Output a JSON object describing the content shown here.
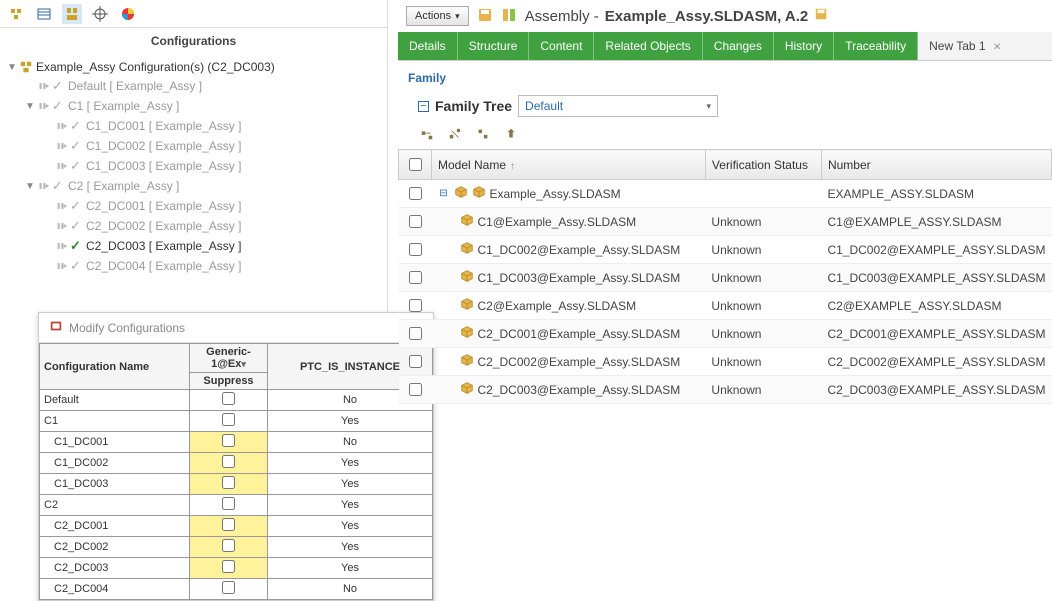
{
  "leftPanel": {
    "title": "Configurations",
    "rootLabel": "Example_Assy Configuration(s)  (C2_DC003)",
    "nodes": [
      {
        "label": "Default [ Example_Assy ]",
        "indent": 1,
        "checked": false,
        "dark": false
      },
      {
        "label": "C1 [ Example_Assy ]",
        "indent": 1,
        "checked": false,
        "dark": false,
        "toggle": "▼"
      },
      {
        "label": "C1_DC001 [ Example_Assy ]",
        "indent": 2,
        "checked": false,
        "dark": false
      },
      {
        "label": "C1_DC002 [ Example_Assy ]",
        "indent": 2,
        "checked": false,
        "dark": false
      },
      {
        "label": "C1_DC003 [ Example_Assy ]",
        "indent": 2,
        "checked": false,
        "dark": false
      },
      {
        "label": "C2 [ Example_Assy ]",
        "indent": 1,
        "checked": false,
        "dark": false,
        "toggle": "▼"
      },
      {
        "label": "C2_DC001 [ Example_Assy ]",
        "indent": 2,
        "checked": false,
        "dark": false
      },
      {
        "label": "C2_DC002 [ Example_Assy ]",
        "indent": 2,
        "checked": false,
        "dark": false
      },
      {
        "label": "C2_DC003 [ Example_Assy ]",
        "indent": 2,
        "checked": true,
        "dark": true
      },
      {
        "label": "C2_DC004 [ Example_Assy ]",
        "indent": 2,
        "checked": false,
        "dark": false
      }
    ]
  },
  "dialog": {
    "title": "Modify Configurations",
    "col1": "Configuration Name",
    "col2a": "Generic-1@Ex",
    "col2b": "Suppress",
    "col3": "PTC_IS_INSTANCE",
    "rows": [
      {
        "name": "Default",
        "indent": 0,
        "yellow": false,
        "ptc": "No"
      },
      {
        "name": "C1",
        "indent": 0,
        "yellow": false,
        "ptc": "Yes"
      },
      {
        "name": "C1_DC001",
        "indent": 1,
        "yellow": true,
        "ptc": "No"
      },
      {
        "name": "C1_DC002",
        "indent": 1,
        "yellow": true,
        "ptc": "Yes"
      },
      {
        "name": "C1_DC003",
        "indent": 1,
        "yellow": true,
        "ptc": "Yes"
      },
      {
        "name": "C2",
        "indent": 0,
        "yellow": false,
        "ptc": "Yes"
      },
      {
        "name": "C2_DC001",
        "indent": 1,
        "yellow": true,
        "ptc": "Yes"
      },
      {
        "name": "C2_DC002",
        "indent": 1,
        "yellow": true,
        "ptc": "Yes"
      },
      {
        "name": "C2_DC003",
        "indent": 1,
        "yellow": true,
        "ptc": "Yes"
      },
      {
        "name": "C2_DC004",
        "indent": 1,
        "yellow": false,
        "ptc": "No"
      }
    ]
  },
  "rightPanel": {
    "actionsLabel": "Actions",
    "titlePrefix": "Assembly - ",
    "titleBold": "Example_Assy.SLDASM, A.2",
    "tabs": [
      "Details",
      "Structure",
      "Content",
      "Related Objects",
      "Changes",
      "History",
      "Traceability"
    ],
    "newTab": "New Tab 1",
    "sectionLabel": "Family",
    "familyTreeLabel": "Family Tree",
    "familyTreeSelected": "Default",
    "columns": {
      "modelName": "Model Name",
      "verification": "Verification Status",
      "number": "Number"
    },
    "rows": [
      {
        "name": "Example_Assy.SLDASM",
        "indent": 0,
        "expand": "-",
        "vs": "",
        "num": "EXAMPLE_ASSY.SLDASM"
      },
      {
        "name": "C1@Example_Assy.SLDASM",
        "indent": 1,
        "vs": "Unknown",
        "num": "C1@EXAMPLE_ASSY.SLDASM"
      },
      {
        "name": "C1_DC002@Example_Assy.SLDASM",
        "indent": 1,
        "vs": "Unknown",
        "num": "C1_DC002@EXAMPLE_ASSY.SLDASM"
      },
      {
        "name": "C1_DC003@Example_Assy.SLDASM",
        "indent": 1,
        "vs": "Unknown",
        "num": "C1_DC003@EXAMPLE_ASSY.SLDASM"
      },
      {
        "name": "C2@Example_Assy.SLDASM",
        "indent": 1,
        "vs": "Unknown",
        "num": "C2@EXAMPLE_ASSY.SLDASM"
      },
      {
        "name": "C2_DC001@Example_Assy.SLDASM",
        "indent": 1,
        "vs": "Unknown",
        "num": "C2_DC001@EXAMPLE_ASSY.SLDASM"
      },
      {
        "name": "C2_DC002@Example_Assy.SLDASM",
        "indent": 1,
        "vs": "Unknown",
        "num": "C2_DC002@EXAMPLE_ASSY.SLDASM"
      },
      {
        "name": "C2_DC003@Example_Assy.SLDASM",
        "indent": 1,
        "vs": "Unknown",
        "num": "C2_DC003@EXAMPLE_ASSY.SLDASM"
      }
    ]
  }
}
